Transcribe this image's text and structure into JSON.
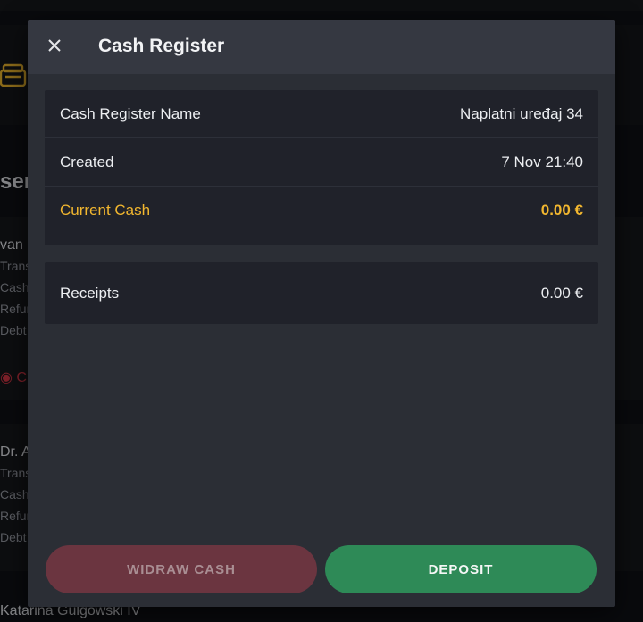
{
  "background": {
    "title_fragment": "sers",
    "cards": [
      {
        "name": "van",
        "lines": [
          "Trans",
          "Cash",
          "Refur",
          "Debt"
        ],
        "alert": "C"
      },
      {
        "name": "Dr. A",
        "lines": [
          "Trans",
          "Cash",
          "Refur",
          "Debt"
        ]
      }
    ],
    "bottom_name": "Katarina Gulgowski IV"
  },
  "modal": {
    "title": "Cash Register",
    "details": [
      {
        "label": "Cash Register Name",
        "value": "Naplatni uređaj 34"
      },
      {
        "label": "Created",
        "value": "7 Nov 21:40"
      },
      {
        "label": "Current Cash",
        "value": "0.00 €"
      }
    ],
    "receipts": {
      "label": "Receipts",
      "value": "0.00 €"
    },
    "buttons": {
      "withdraw": "WIDRAW CASH",
      "deposit": "DEPOSIT"
    }
  },
  "colors": {
    "accent": "#f2b72f",
    "deposit": "#2e8a57",
    "withdraw": "#6b3540",
    "alert": "#c2323f"
  }
}
